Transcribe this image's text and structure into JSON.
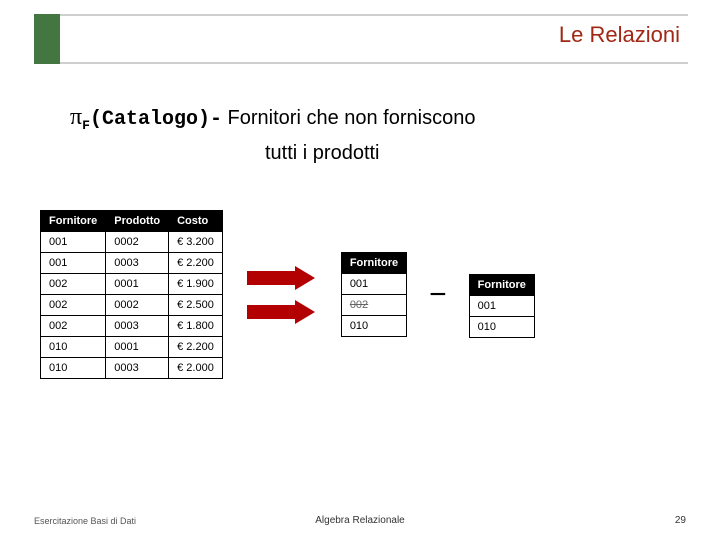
{
  "slide": {
    "title": "Le Relazioni",
    "footer_left": "Esercitazione Basi di Dati",
    "footer_center": "Algebra Relazionale",
    "page_no": "29"
  },
  "expr": {
    "pi": "π",
    "sub": "F",
    "paren": "(Catalogo)",
    "dash": "-",
    "text1": "Fornitori che non forniscono",
    "text2": "tutti i prodotti"
  },
  "catalogo": {
    "headers": {
      "c0": "Fornitore",
      "c1": "Prodotto",
      "c2": "Costo"
    },
    "rows": [
      {
        "c0": "001",
        "c1": "0002",
        "c2": "€ 3.200"
      },
      {
        "c0": "001",
        "c1": "0003",
        "c2": "€ 2.200"
      },
      {
        "c0": "002",
        "c1": "0001",
        "c2": "€ 1.900"
      },
      {
        "c0": "002",
        "c1": "0002",
        "c2": "€ 2.500"
      },
      {
        "c0": "002",
        "c1": "0003",
        "c2": "€ 1.800"
      },
      {
        "c0": "010",
        "c1": "0001",
        "c2": "€ 2.200"
      },
      {
        "c0": "010",
        "c1": "0003",
        "c2": "€ 2.000"
      }
    ]
  },
  "middle": {
    "header": "Fornitore",
    "rows": [
      {
        "v": "001",
        "struck": false
      },
      {
        "v": "002",
        "struck": true
      },
      {
        "v": "010",
        "struck": false
      }
    ]
  },
  "result": {
    "header": "Fornitore",
    "rows": [
      {
        "v": "001"
      },
      {
        "v": "010"
      }
    ]
  },
  "ops": {
    "minus": "−"
  }
}
